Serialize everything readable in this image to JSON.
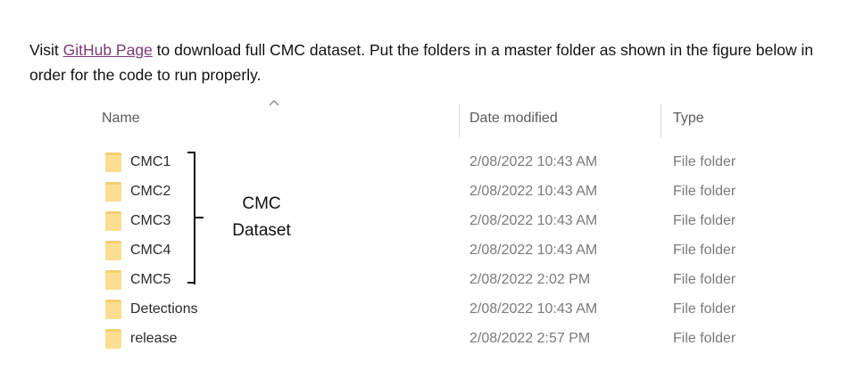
{
  "intro": {
    "prefix": "Visit ",
    "link_text": "GitHub Page",
    "suffix": " to download full CMC dataset. Put the folders in a master folder as shown in the figure below in order for the code to run properly."
  },
  "explorer": {
    "columns": {
      "name": "Name",
      "date": "Date modified",
      "type": "Type"
    },
    "rows": [
      {
        "name": "CMC1",
        "date": "2/08/2022 10:43 AM",
        "type": "File folder"
      },
      {
        "name": "CMC2",
        "date": "2/08/2022 10:43 AM",
        "type": "File folder"
      },
      {
        "name": "CMC3",
        "date": "2/08/2022 10:43 AM",
        "type": "File folder"
      },
      {
        "name": "CMC4",
        "date": "2/08/2022 10:43 AM",
        "type": "File folder"
      },
      {
        "name": "CMC5",
        "date": "2/08/2022 2:02 PM",
        "type": "File folder"
      },
      {
        "name": "Detections",
        "date": "2/08/2022 10:43 AM",
        "type": "File folder"
      },
      {
        "name": "release",
        "date": "2/08/2022 2:57 PM",
        "type": "File folder"
      }
    ]
  },
  "annotation": {
    "line1": "CMC",
    "line2": "Dataset"
  },
  "icons": {
    "folder": "folder-icon",
    "sort": "sort-ascending-caret-icon"
  },
  "colors": {
    "link": "#7a3b76",
    "folder": "#fadf92",
    "muted_text": "#7a7a7a"
  }
}
